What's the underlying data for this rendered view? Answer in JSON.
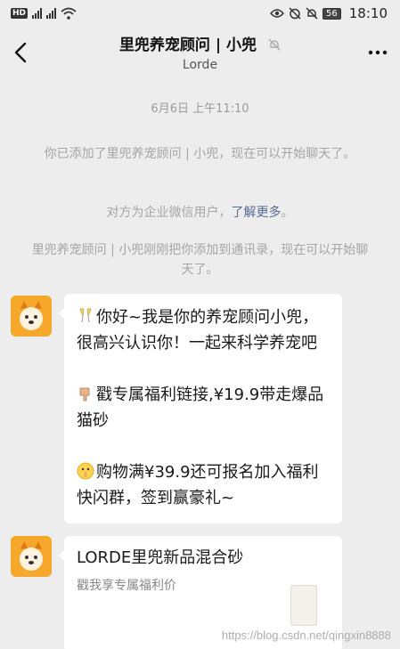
{
  "status_bar": {
    "hd": "HD",
    "sig1_tag": "2G",
    "sig2_tag": "4G",
    "battery": "56",
    "time": "18:10"
  },
  "header": {
    "title": "里兜养宠顾问 | 小兜",
    "subtitle": "Lorde"
  },
  "system": {
    "timestamp": "6月6日 上午11:10",
    "added_msg": "你已添加了里兜养宠顾问 | 小兜，现在可以开始聊天了。",
    "corp_prefix": "对方为企业微信用户，",
    "corp_link": "了解更多",
    "corp_suffix": "。",
    "contact_msg": "里兜养宠顾问 | 小兜刚刚把你添加到通讯录，现在可以开始聊天了。"
  },
  "messages": {
    "m1_line1": "你好~我是你的养宠顾问小兜，很高兴认识你！一起来科学养宠吧",
    "m1_line2": "戳专属福利链接,¥19.9带走爆品猫砂",
    "m1_line3": "购物满¥39.9还可报名加入福利快闪群，签到赢豪礼~",
    "card_title": "LORDE里兜新品混合砂",
    "card_desc": "戳我享专属福利价"
  },
  "watermark": "https://blog.csdn.net/qingxin8888"
}
